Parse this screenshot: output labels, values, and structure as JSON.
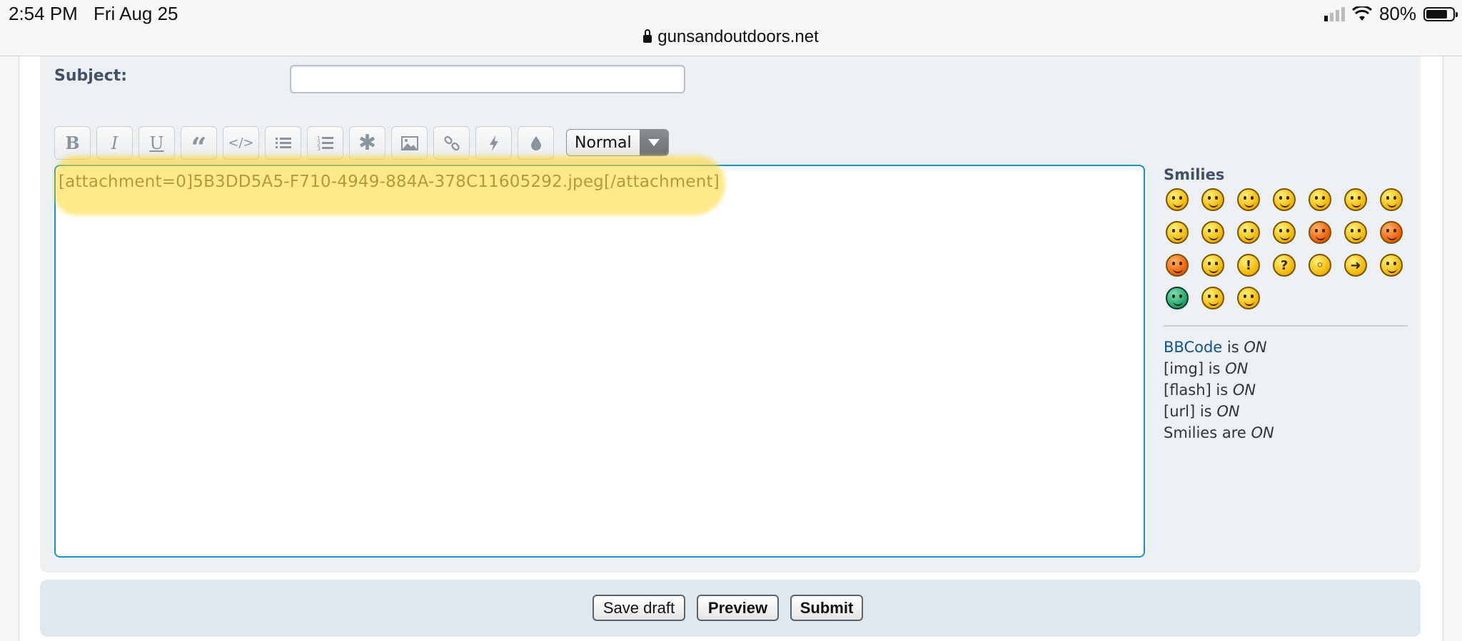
{
  "status_bar": {
    "time": "2:54 PM",
    "date": "Fri Aug 25",
    "battery": "80%",
    "battery_level": 0.8,
    "url": "gunsandoutdoors.net"
  },
  "form": {
    "subject_label": "Subject:",
    "subject_value": ""
  },
  "toolbar": {
    "buttons": [
      {
        "name": "bold",
        "label": "B"
      },
      {
        "name": "italic",
        "label": "I"
      },
      {
        "name": "underline",
        "label": "U"
      },
      {
        "name": "quote",
        "label": "“"
      },
      {
        "name": "code",
        "label": "</>"
      },
      {
        "name": "list",
        "label": ""
      },
      {
        "name": "ordered-list",
        "label": ""
      },
      {
        "name": "list-item",
        "label": "✱"
      },
      {
        "name": "image",
        "label": ""
      },
      {
        "name": "link",
        "label": ""
      },
      {
        "name": "flash",
        "label": ""
      },
      {
        "name": "color",
        "label": ""
      }
    ],
    "font_size_value": "Normal"
  },
  "editor": {
    "content": "[attachment=0]5B3DD5A5-F710-4949-884A-378C11605292.jpeg[/attachment]",
    "highlight_color": "#ffd728"
  },
  "smilies": {
    "title": "Smilies",
    "count": 24
  },
  "bbcode_status": {
    "bbcode_link": "BBCode",
    "bbcode_is": "is",
    "bbcode_state": "ON",
    "img_label": "[img] is",
    "img_state": "ON",
    "flash_label": "[flash] is",
    "flash_state": "ON",
    "url_label": "[url] is",
    "url_state": "ON",
    "smilies_label": "Smilies are",
    "smilies_state": "ON"
  },
  "actions": {
    "save_draft": "Save draft",
    "preview": "Preview",
    "submit": "Submit"
  },
  "colors": {
    "accent_border": "#1c91c6",
    "panel_bg": "#ecf0f3",
    "link": "#105289"
  }
}
